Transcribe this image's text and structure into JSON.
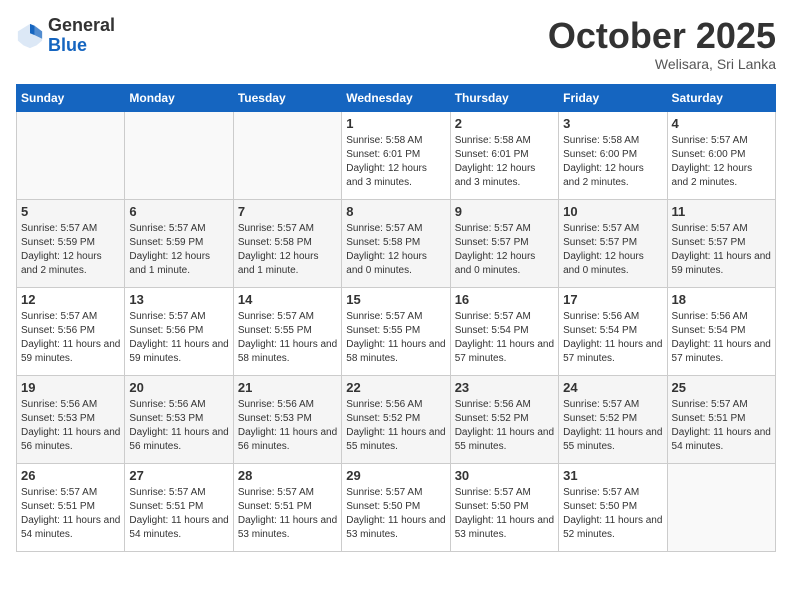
{
  "header": {
    "logo_general": "General",
    "logo_blue": "Blue",
    "month": "October 2025",
    "location": "Welisara, Sri Lanka"
  },
  "days_of_week": [
    "Sunday",
    "Monday",
    "Tuesday",
    "Wednesday",
    "Thursday",
    "Friday",
    "Saturday"
  ],
  "weeks": [
    [
      {
        "day": "",
        "info": ""
      },
      {
        "day": "",
        "info": ""
      },
      {
        "day": "",
        "info": ""
      },
      {
        "day": "1",
        "info": "Sunrise: 5:58 AM\nSunset: 6:01 PM\nDaylight: 12 hours\nand 3 minutes."
      },
      {
        "day": "2",
        "info": "Sunrise: 5:58 AM\nSunset: 6:01 PM\nDaylight: 12 hours\nand 3 minutes."
      },
      {
        "day": "3",
        "info": "Sunrise: 5:58 AM\nSunset: 6:00 PM\nDaylight: 12 hours\nand 2 minutes."
      },
      {
        "day": "4",
        "info": "Sunrise: 5:57 AM\nSunset: 6:00 PM\nDaylight: 12 hours\nand 2 minutes."
      }
    ],
    [
      {
        "day": "5",
        "info": "Sunrise: 5:57 AM\nSunset: 5:59 PM\nDaylight: 12 hours\nand 2 minutes."
      },
      {
        "day": "6",
        "info": "Sunrise: 5:57 AM\nSunset: 5:59 PM\nDaylight: 12 hours\nand 1 minute."
      },
      {
        "day": "7",
        "info": "Sunrise: 5:57 AM\nSunset: 5:58 PM\nDaylight: 12 hours\nand 1 minute."
      },
      {
        "day": "8",
        "info": "Sunrise: 5:57 AM\nSunset: 5:58 PM\nDaylight: 12 hours\nand 0 minutes."
      },
      {
        "day": "9",
        "info": "Sunrise: 5:57 AM\nSunset: 5:57 PM\nDaylight: 12 hours\nand 0 minutes."
      },
      {
        "day": "10",
        "info": "Sunrise: 5:57 AM\nSunset: 5:57 PM\nDaylight: 12 hours\nand 0 minutes."
      },
      {
        "day": "11",
        "info": "Sunrise: 5:57 AM\nSunset: 5:57 PM\nDaylight: 11 hours\nand 59 minutes."
      }
    ],
    [
      {
        "day": "12",
        "info": "Sunrise: 5:57 AM\nSunset: 5:56 PM\nDaylight: 11 hours\nand 59 minutes."
      },
      {
        "day": "13",
        "info": "Sunrise: 5:57 AM\nSunset: 5:56 PM\nDaylight: 11 hours\nand 59 minutes."
      },
      {
        "day": "14",
        "info": "Sunrise: 5:57 AM\nSunset: 5:55 PM\nDaylight: 11 hours\nand 58 minutes."
      },
      {
        "day": "15",
        "info": "Sunrise: 5:57 AM\nSunset: 5:55 PM\nDaylight: 11 hours\nand 58 minutes."
      },
      {
        "day": "16",
        "info": "Sunrise: 5:57 AM\nSunset: 5:54 PM\nDaylight: 11 hours\nand 57 minutes."
      },
      {
        "day": "17",
        "info": "Sunrise: 5:56 AM\nSunset: 5:54 PM\nDaylight: 11 hours\nand 57 minutes."
      },
      {
        "day": "18",
        "info": "Sunrise: 5:56 AM\nSunset: 5:54 PM\nDaylight: 11 hours\nand 57 minutes."
      }
    ],
    [
      {
        "day": "19",
        "info": "Sunrise: 5:56 AM\nSunset: 5:53 PM\nDaylight: 11 hours\nand 56 minutes."
      },
      {
        "day": "20",
        "info": "Sunrise: 5:56 AM\nSunset: 5:53 PM\nDaylight: 11 hours\nand 56 minutes."
      },
      {
        "day": "21",
        "info": "Sunrise: 5:56 AM\nSunset: 5:53 PM\nDaylight: 11 hours\nand 56 minutes."
      },
      {
        "day": "22",
        "info": "Sunrise: 5:56 AM\nSunset: 5:52 PM\nDaylight: 11 hours\nand 55 minutes."
      },
      {
        "day": "23",
        "info": "Sunrise: 5:56 AM\nSunset: 5:52 PM\nDaylight: 11 hours\nand 55 minutes."
      },
      {
        "day": "24",
        "info": "Sunrise: 5:57 AM\nSunset: 5:52 PM\nDaylight: 11 hours\nand 55 minutes."
      },
      {
        "day": "25",
        "info": "Sunrise: 5:57 AM\nSunset: 5:51 PM\nDaylight: 11 hours\nand 54 minutes."
      }
    ],
    [
      {
        "day": "26",
        "info": "Sunrise: 5:57 AM\nSunset: 5:51 PM\nDaylight: 11 hours\nand 54 minutes."
      },
      {
        "day": "27",
        "info": "Sunrise: 5:57 AM\nSunset: 5:51 PM\nDaylight: 11 hours\nand 54 minutes."
      },
      {
        "day": "28",
        "info": "Sunrise: 5:57 AM\nSunset: 5:51 PM\nDaylight: 11 hours\nand 53 minutes."
      },
      {
        "day": "29",
        "info": "Sunrise: 5:57 AM\nSunset: 5:50 PM\nDaylight: 11 hours\nand 53 minutes."
      },
      {
        "day": "30",
        "info": "Sunrise: 5:57 AM\nSunset: 5:50 PM\nDaylight: 11 hours\nand 53 minutes."
      },
      {
        "day": "31",
        "info": "Sunrise: 5:57 AM\nSunset: 5:50 PM\nDaylight: 11 hours\nand 52 minutes."
      },
      {
        "day": "",
        "info": ""
      }
    ]
  ]
}
